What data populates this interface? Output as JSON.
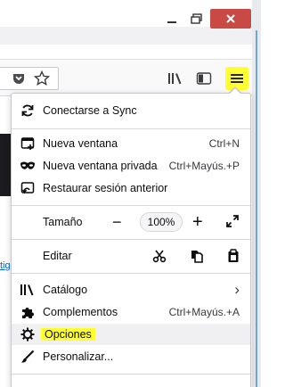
{
  "menu": {
    "sync": {
      "label": "Conectarse a Sync",
      "icon": "sync-icon"
    },
    "new_window": {
      "label": "Nueva ventana",
      "shortcut": "Ctrl+N",
      "icon": "new-window-icon"
    },
    "private_window": {
      "label": "Nueva ventana privada",
      "shortcut": "Ctrl+Mayús.+P",
      "icon": "private-mask-icon"
    },
    "restore_session": {
      "label": "Restaurar sesión anterior",
      "icon": "restore-session-icon"
    },
    "zoom": {
      "label": "Tamaño",
      "minus": "−",
      "value": "100%",
      "plus": "+",
      "icon": "fullscreen-icon"
    },
    "edit": {
      "label": "Editar",
      "icons": [
        "cut-icon",
        "copy-icon",
        "paste-icon"
      ]
    },
    "library": {
      "label": "Catálogo",
      "icon": "library-icon",
      "chevron": "›"
    },
    "addons": {
      "label": "Complementos",
      "shortcut": "Ctrl+Mayús.+A",
      "icon": "puzzle-icon"
    },
    "options": {
      "label": "Opciones",
      "icon": "gear-icon",
      "highlight": "#ffff2f"
    },
    "customize": {
      "label": "Personalizar...",
      "icon": "paintbrush-icon"
    }
  },
  "toolbar": {
    "icons": [
      "pocket-icon",
      "star-icon",
      "library-icon",
      "sidebar-icon",
      "hamburger-menu-icon"
    ]
  },
  "page": {
    "link_fragment": "tig"
  }
}
